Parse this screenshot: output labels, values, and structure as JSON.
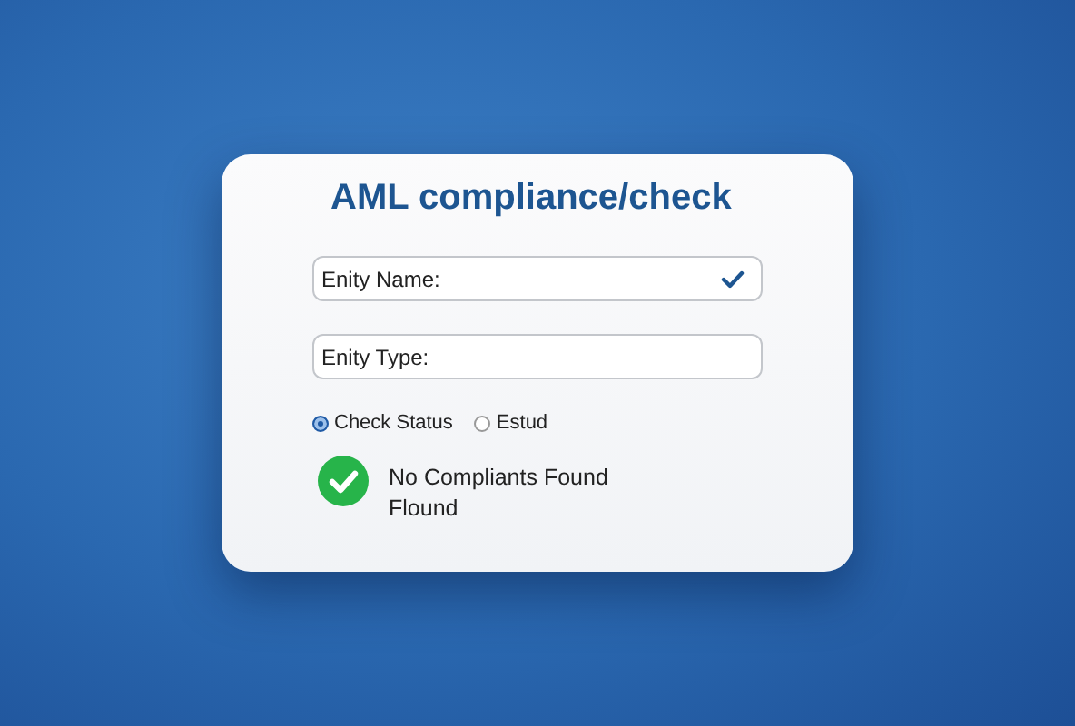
{
  "title": "AML compliance/check",
  "fields": [
    {
      "value": "Enity Name:",
      "verified": true
    },
    {
      "value": "Enity Type:",
      "verified": false
    }
  ],
  "radios": [
    {
      "label": "Check Status",
      "selected": true
    },
    {
      "label": "Estud",
      "selected": false
    }
  ],
  "result": {
    "passed": true,
    "lines": [
      "No Compliants Found",
      "Flound"
    ]
  }
}
